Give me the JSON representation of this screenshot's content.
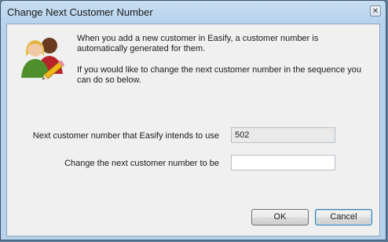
{
  "window": {
    "title": "Change Next Customer Number",
    "close_symbol": "✕"
  },
  "icons": {
    "header_icon": "customers-edit-icon"
  },
  "message": {
    "line1": "When you add a new customer in Easify, a customer number is automatically generated for them.",
    "line2": "If you would like to change the next customer number in the sequence you can do so below."
  },
  "form": {
    "current_label": "Next customer number that Easify intends to use",
    "current_value": "502",
    "new_label": "Change the next customer number to be",
    "new_value": ""
  },
  "buttons": {
    "ok": "OK",
    "cancel": "Cancel"
  }
}
